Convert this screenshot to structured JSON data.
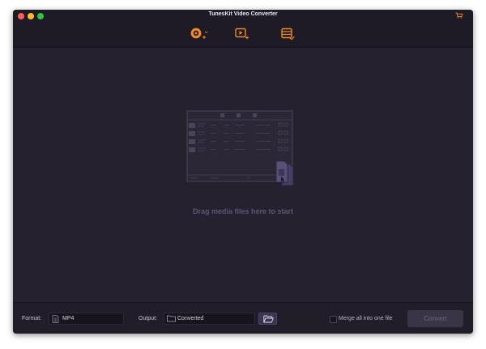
{
  "window": {
    "title": "TunesKit Video Converter"
  },
  "toolbar": {
    "icons": [
      "add-cd-icon",
      "add-video-icon",
      "converted-list-icon"
    ],
    "accent_color": "#f08c1e"
  },
  "drop_area": {
    "hint": "Drag media files here to start"
  },
  "bottom_bar": {
    "format_label": "Format:",
    "format_value": "MP4",
    "output_label": "Output:",
    "output_value": "Converted",
    "merge_label": "Merge all into one file",
    "merge_checked": false,
    "convert_label": "Convert"
  }
}
